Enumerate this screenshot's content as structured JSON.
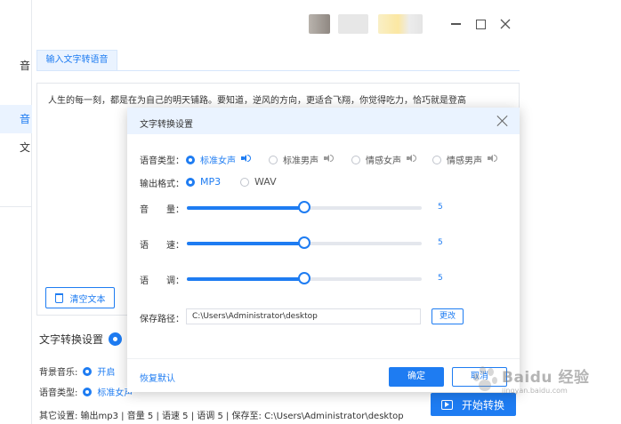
{
  "left_nav": {
    "items": [
      "音",
      "音",
      "文"
    ]
  },
  "main": {
    "tab_label": "输入文字转语音",
    "editor_text": "人生的每一刻，都是在为自己的明天铺路。要知道，逆风的方向，更适合飞翔，你觉得吃力，恰巧就是登高",
    "clear_button": "清空文本",
    "settings_title": "文字转换设置",
    "bg_music_label": "背景音乐:",
    "bg_music_value": "开启",
    "voice_type_label": "语音类型:",
    "voice_type_value": "标准女声",
    "summary": "其它设置:   输出mp3  |  音量 5  |  语速 5  |  语调 5  |  保存至: C:\\Users\\Administrator\\desktop",
    "start_button": "开始转换"
  },
  "dialog": {
    "title": "文字转换设置",
    "voice_type_label": "语音类型：",
    "voice_options": [
      "标准女声",
      "标准男声",
      "情感女声",
      "情感男声"
    ],
    "voice_selected": 0,
    "format_label": "输出格式：",
    "format_options": [
      "MP3",
      "WAV"
    ],
    "format_selected": 0,
    "volume_label": "音　　量：",
    "speed_label": "语　　速：",
    "pitch_label": "语　　调：",
    "volume": 5,
    "speed": 5,
    "pitch": 5,
    "slider_fraction": 0.5,
    "save_path_label": "保存路径：",
    "save_path": "C:\\Users\\Administrator\\desktop",
    "change_button": "更改",
    "reset_link": "恢复默认",
    "ok_button": "确定",
    "cancel_button": "取消"
  },
  "watermark": {
    "text": "Baidu 经验",
    "sub": "jingyan.baidu.com"
  },
  "colors": {
    "accent": "#1e7cf2",
    "header_bg": "#eaf3ff"
  }
}
